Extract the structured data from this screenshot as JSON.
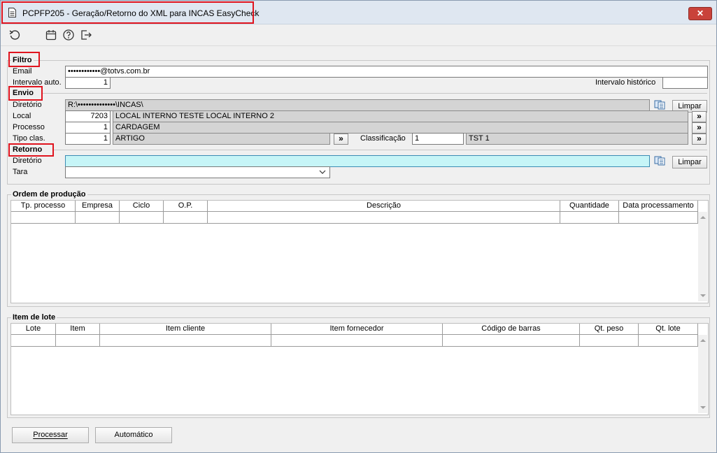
{
  "window": {
    "title": "PCPFP205 - Geração/Retorno do XML para INCAS EasyCheck",
    "close_label": "✕"
  },
  "toolbar": {
    "icons": [
      "refresh-icon",
      "calendar-icon",
      "help-icon",
      "exit-icon"
    ]
  },
  "filtro": {
    "title": "Filtro",
    "email_label": "Email",
    "email_value": "••••••••••••@totvs.com.br",
    "intervalo_auto_label": "Intervalo auto.",
    "intervalo_auto_value": "1",
    "intervalo_historico_label": "Intervalo histórico",
    "intervalo_historico_value": ""
  },
  "envio": {
    "title": "Envio",
    "diretorio_label": "Diretório",
    "diretorio_value": "R:\\••••••••••••••\\INCAS\\",
    "limpar_label": "Limpar",
    "local_label": "Local",
    "local_code": "7203",
    "local_desc": "LOCAL INTERNO TESTE LOCAL INTERNO 2",
    "processo_label": "Processo",
    "processo_code": "1",
    "processo_desc": "CARDAGEM",
    "tipo_clas_label": "Tipo clas.",
    "tipo_clas_code": "1",
    "tipo_clas_desc": "ARTIGO",
    "classificacao_label": "Classificação",
    "classificacao_code": "1",
    "classificacao_desc": "TST 1",
    "more_label": "»"
  },
  "retorno": {
    "title": "Retorno",
    "diretorio_label": "Diretório",
    "diretorio_value": "",
    "limpar_label": "Limpar",
    "tara_label": "Tara",
    "tara_value": ""
  },
  "ordem": {
    "title": "Ordem de produção",
    "columns": [
      "Tp. processo",
      "Empresa",
      "Ciclo",
      "O.P.",
      "Descrição",
      "Quantidade",
      "Data processamento"
    ]
  },
  "lote": {
    "title": "Item de lote",
    "columns": [
      "Lote",
      "Item",
      "Item cliente",
      "Item fornecedor",
      "Código de barras",
      "Qt. peso",
      "Qt. lote"
    ]
  },
  "footer": {
    "processar_label": "Processar",
    "automatico_label": "Automático"
  },
  "colors": {
    "highlight": "#e0141e",
    "cyan_field": "#c6f5f7",
    "close": "#c9423a"
  }
}
